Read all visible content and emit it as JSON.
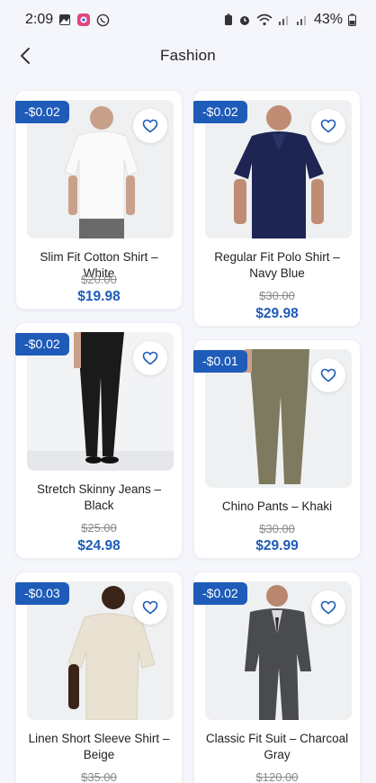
{
  "status_bar": {
    "time": "2:09",
    "battery": "43%"
  },
  "header": {
    "title": "Fashion"
  },
  "products": [
    {
      "badge": "-$0.02",
      "name": "Slim Fit Cotton Shirt – White",
      "old_price": "$20.00",
      "price": "$19.98",
      "image": "white-tshirt"
    },
    {
      "badge": "-$0.02",
      "name": "Regular Fit Polo Shirt – Navy Blue",
      "old_price": "$30.00",
      "price": "$29.98",
      "image": "navy-polo"
    },
    {
      "badge": "-$0.02",
      "name": "Stretch Skinny Jeans – Black",
      "old_price": "$25.00",
      "price": "$24.98",
      "image": "black-jeans"
    },
    {
      "badge": "-$0.01",
      "name": "Chino Pants – Khaki",
      "old_price": "$30.00",
      "price": "$29.99",
      "image": "khaki-chinos"
    },
    {
      "badge": "-$0.03",
      "name": "Linen Short Sleeve Shirt – Beige",
      "old_price": "$35.00",
      "price": "",
      "image": "beige-linen-shirt"
    },
    {
      "badge": "-$0.02",
      "name": "Classic Fit Suit – Charcoal Gray",
      "old_price": "$120.00",
      "price": "",
      "image": "charcoal-suit"
    }
  ],
  "colors": {
    "accent": "#1f5bb8",
    "background": "#f4f6fb"
  }
}
